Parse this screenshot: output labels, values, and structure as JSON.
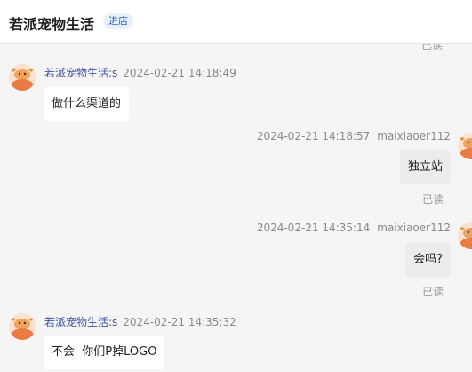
{
  "header": {
    "shop_name": "若派宠物生活",
    "enter_label": "进店"
  },
  "chat": {
    "cut_off_read": "已读",
    "messages": [
      {
        "direction": "in",
        "sender": "若派宠物生活:s",
        "time": "2024-02-21 14:18:49",
        "text": "做什么渠道的"
      },
      {
        "direction": "out",
        "sender": "maixiaoer112",
        "time": "2024-02-21 14:18:57",
        "text": "独立站",
        "status": "已读"
      },
      {
        "direction": "out",
        "sender": "maixiaoer112",
        "time": "2024-02-21 14:35:14",
        "text": "会吗?",
        "status": "已读"
      },
      {
        "direction": "in",
        "sender": "若派宠物生活:s",
        "time": "2024-02-21 14:35:32",
        "text": "不会  你们P掉LOGO"
      }
    ]
  },
  "icons": {
    "avatar": "pet-mascot-avatar-icon"
  },
  "colors": {
    "background": "#f5f5f5",
    "sender_name": "#3b53a6",
    "incoming_bubble": "#ffffff",
    "outgoing_bubble": "#ececec",
    "badge_text": "#2f5fb3"
  }
}
